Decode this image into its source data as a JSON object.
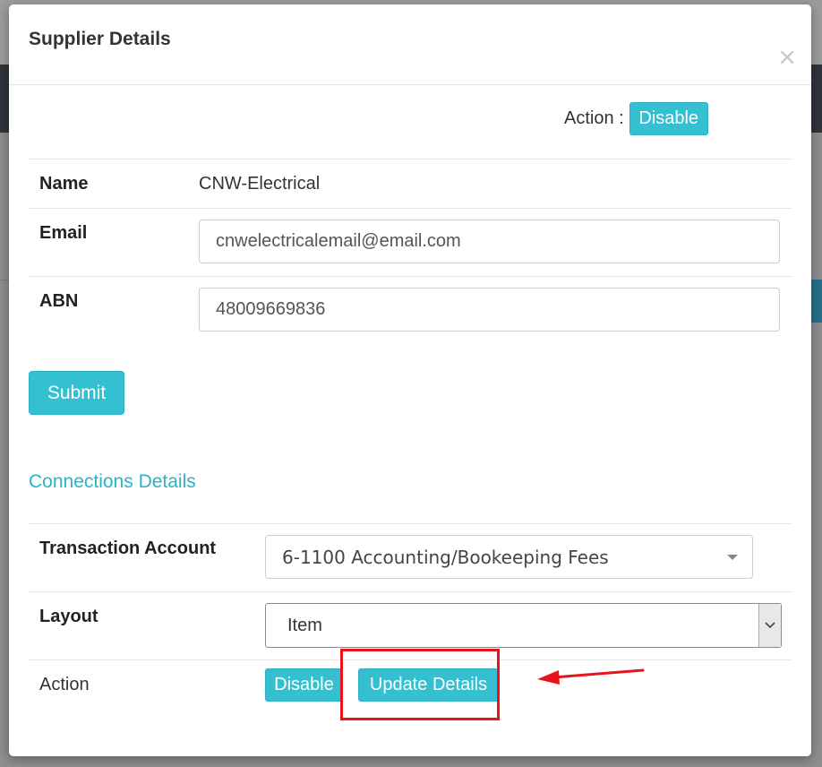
{
  "modal": {
    "title": "Supplier Details",
    "close_glyph": "×"
  },
  "top_action": {
    "label": "Action :",
    "disable_button": "Disable"
  },
  "details": {
    "name_label": "Name",
    "name_value": "CNW-Electrical",
    "email_label": "Email",
    "email_value": "cnwelectricalemail@email.com",
    "abn_label": "ABN",
    "abn_value": "48009669836"
  },
  "submit_label": "Submit",
  "connections": {
    "title": "Connections Details",
    "transaction_label": "Transaction Account",
    "transaction_value": "6-1100 Accounting/Bookeeping Fees",
    "layout_label": "Layout",
    "layout_value": "Item",
    "action_label": "Action",
    "disable_button": "Disable",
    "update_button": "Update Details"
  },
  "annotation": {
    "highlight_color": "#e8141c"
  },
  "colors": {
    "accent": "#34c0d0",
    "section_title": "#2bb3c6"
  }
}
